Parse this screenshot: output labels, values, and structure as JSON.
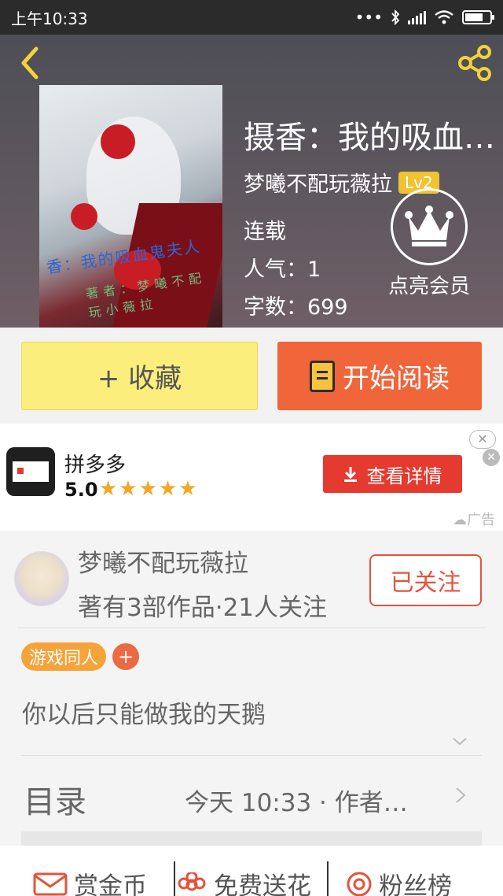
{
  "status": {
    "time": "上午10:33"
  },
  "book": {
    "title": "摄香：我的吸血…",
    "author": "梦曦不配玩薇拉",
    "level": "Lv2",
    "state": "连载",
    "popularity": "人气：1",
    "word_count": "字数：699",
    "cover_text": "香：我的吸血鬼夫人",
    "cover_author_text": "著者：梦曦不配玩小薇拉"
  },
  "vip": {
    "label": "点亮会员"
  },
  "actions": {
    "collect": "+ 收藏",
    "read": "开始阅读"
  },
  "ad": {
    "app_name": "拼多多",
    "rating": "5.0",
    "stars": "★★★★★",
    "button": "查看详情",
    "tag": "广告"
  },
  "author_card": {
    "name": "梦曦不配玩薇拉",
    "stats": "著有3部作品·21人关注",
    "follow": "已关注"
  },
  "tags": {
    "items": [
      "游戏同人"
    ],
    "add": "+"
  },
  "intro": "你以后只能做我的天鹅",
  "toc": {
    "label": "目录",
    "update": "今天 10:33 · 作者…"
  },
  "bottom": {
    "reward": "赏金币",
    "flower": "免费送花",
    "fans": "粉丝榜"
  },
  "colors": {
    "accent_orange": "#f0653a",
    "collect_yellow": "#fbee7d",
    "follow_red": "#e5533b",
    "tag_orange": "#f5a33a"
  }
}
